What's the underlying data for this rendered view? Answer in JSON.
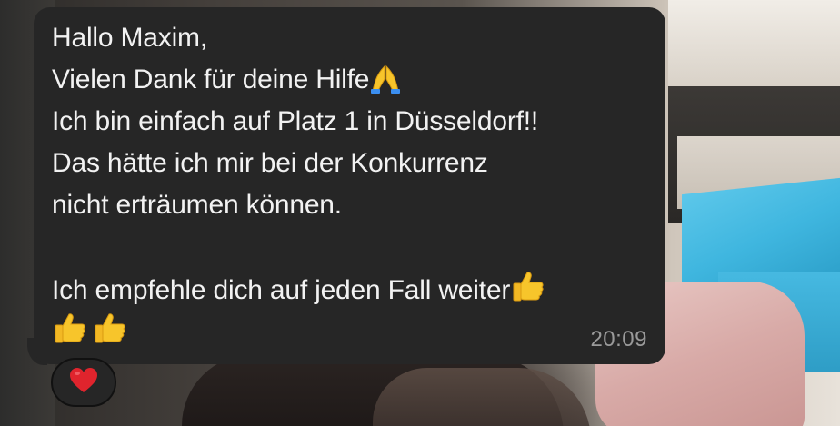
{
  "message": {
    "lines": [
      "Hallo Maxim,",
      "Vielen Dank für deine Hilfe",
      "Ich bin einfach auf Platz 1 in Düsseldorf!!",
      "Das hätte ich mir bei der Konkurrenz",
      "nicht erträumen können.",
      "",
      "Ich empfehle dich auf jeden Fall weiter",
      ""
    ],
    "emojis": {
      "line2": "folded-hands-emoji",
      "line7": "thumbs-up-emoji",
      "line8": [
        "thumbs-up-emoji",
        "thumbs-up-emoji"
      ]
    },
    "timestamp": "20:09"
  },
  "reaction": {
    "emoji": "red-heart-emoji"
  },
  "colors": {
    "bubble": "#262626",
    "text": "#f2f2f2",
    "timestamp": "#9a9a9a",
    "emoji_yellow": "#f7c52b",
    "heart_red": "#e0242d"
  }
}
